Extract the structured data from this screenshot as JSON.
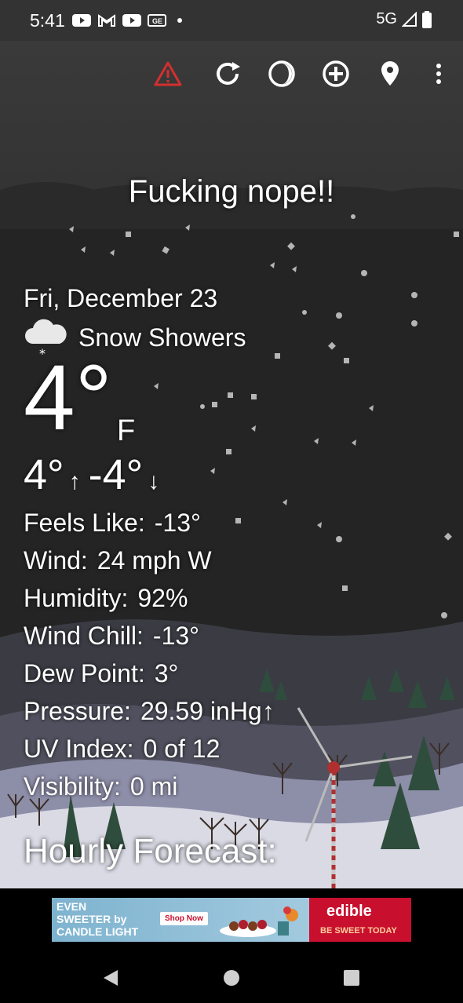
{
  "status_bar": {
    "time": "5:41",
    "network": "5G",
    "notification_icons": [
      "youtube-icon",
      "gmail-icon",
      "youtube-icon",
      "news-icon"
    ]
  },
  "toolbar": {
    "icons": [
      "alert-triangle-icon",
      "refresh-icon",
      "moon-phase-icon",
      "add-circle-icon",
      "location-pin-icon",
      "more-vert-icon"
    ],
    "alert_color": "#d32f2f"
  },
  "weather": {
    "headline": "Fucking nope!!",
    "date": "Fri, December 23",
    "condition": "Snow Showers",
    "temperature": "4°",
    "unit": "F",
    "high": "4°",
    "low": "-4°",
    "high_arrow": "↑",
    "low_arrow": "↓",
    "details": [
      {
        "label": "Feels Like:",
        "value": "-13°"
      },
      {
        "label": "Wind:",
        "value": "24 mph W"
      },
      {
        "label": "Humidity:",
        "value": "92%"
      },
      {
        "label": "Wind Chill:",
        "value": "-13°"
      },
      {
        "label": "Dew Point:",
        "value": "3°"
      },
      {
        "label": "Pressure:",
        "value": "29.59 inHg↑"
      },
      {
        "label": "UV Index:",
        "value": "0 of 12"
      },
      {
        "label": "Visibility:",
        "value": "0 mi"
      }
    ],
    "hourly_title": "Hourly Forecast:"
  },
  "ad": {
    "left_line1": "EVEN",
    "left_line2": "SWEETER by",
    "left_line3": "CANDLE LIGHT",
    "shop_now": "Shop Now",
    "brand": "edible",
    "tagline": "BE SWEET TODAY",
    "brand_color": "#c8102e"
  },
  "nav": {
    "icons": [
      "back-icon",
      "home-icon",
      "recents-icon"
    ]
  }
}
